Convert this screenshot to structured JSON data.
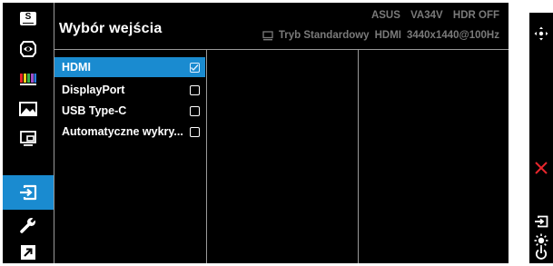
{
  "osd": {
    "title": "Wybór wejścia",
    "model_info": {
      "brand": "ASUS",
      "model": "VA34V",
      "hdr": "HDR OFF"
    },
    "status": {
      "mode": "Tryb Standardowy",
      "input": "HDMI",
      "resolution": "3440x1440@100Hz"
    }
  },
  "sidebar": {
    "items": [
      {
        "name": "splendid",
        "icon": "s-badge-icon",
        "label": "S"
      },
      {
        "name": "blue-light",
        "icon": "eye-icon"
      },
      {
        "name": "color",
        "icon": "color-bars-icon"
      },
      {
        "name": "image",
        "icon": "landscape-image-icon"
      },
      {
        "name": "pip",
        "icon": "pip-icon"
      },
      {
        "name": "input-select",
        "icon": "input-arrow-icon",
        "active": true
      },
      {
        "name": "system-setup",
        "icon": "wrench-icon"
      },
      {
        "name": "shortcut",
        "icon": "shortcut-arrow-icon"
      }
    ]
  },
  "menu": {
    "items": [
      {
        "label": "HDMI",
        "selected": true,
        "checked": true
      },
      {
        "label": "DisplayPort",
        "selected": false,
        "checked": false
      },
      {
        "label": "USB Type-C",
        "selected": false,
        "checked": false
      },
      {
        "label": "Automatyczne wykry...",
        "selected": false,
        "checked": false
      }
    ]
  },
  "controls": {
    "buttons": [
      "joystick-icon",
      "close-icon",
      "input-icon",
      "brightness-icon",
      "power-icon"
    ]
  },
  "colors": {
    "accent": "#1a8bd0",
    "background": "#000000",
    "header_text": "#7a7a7a",
    "close": "#e8262c"
  }
}
